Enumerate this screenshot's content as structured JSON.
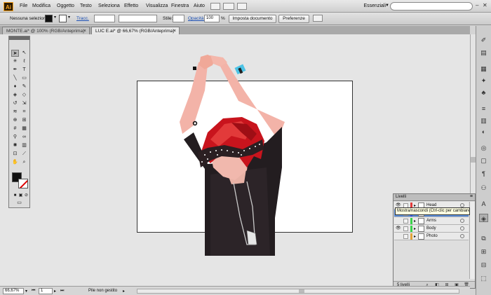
{
  "app": {
    "logo": "Ai"
  },
  "menu": [
    "File",
    "Modifica",
    "Oggetto",
    "Testo",
    "Seleziona",
    "Effetto",
    "Visualizza",
    "Finestra",
    "Aiuto"
  ],
  "workspace": "Essenziali",
  "control_bar": {
    "selection": "Nessuna selezione",
    "stroke_label": "Tracc.",
    "style_label": "Stile:",
    "opacity_label": "Opacità:",
    "opacity_value": "100",
    "opacity_unit": "%",
    "document_setup": "Imposta documento",
    "preferences": "Preferenze"
  },
  "tabs": [
    {
      "label": "MONTE.ai* @ 100% (RGB/Anteprima)",
      "active": false
    },
    {
      "label": "LUC E.ai* @ 66,67% (RGB/Anteprima)",
      "active": true
    }
  ],
  "status": {
    "zoom": "66,67%",
    "page": "1",
    "info": "Pile non gestito"
  },
  "layers_panel": {
    "title": "Livelli",
    "layers": [
      {
        "name": "Head",
        "color": "#e23a3a",
        "visible": true,
        "selected": false
      },
      {
        "name": "",
        "color": "#3a5be2",
        "visible": true,
        "selected": true
      },
      {
        "name": "Arms",
        "color": "#3ad24a",
        "visible": false,
        "selected": false
      },
      {
        "name": "Body",
        "color": "#3ad24a",
        "visible": true,
        "selected": false
      },
      {
        "name": "Photo",
        "color": "#e2a33a",
        "visible": false,
        "selected": false
      }
    ],
    "count": "5 livelli"
  },
  "tooltip": "Mostra/nascondi (Ctrl-clic per cambiare vista)",
  "colors": {
    "fill": "#111111",
    "stroke": "#ffffff",
    "hair": "#c8141d",
    "selection": "#5b8ed9"
  }
}
